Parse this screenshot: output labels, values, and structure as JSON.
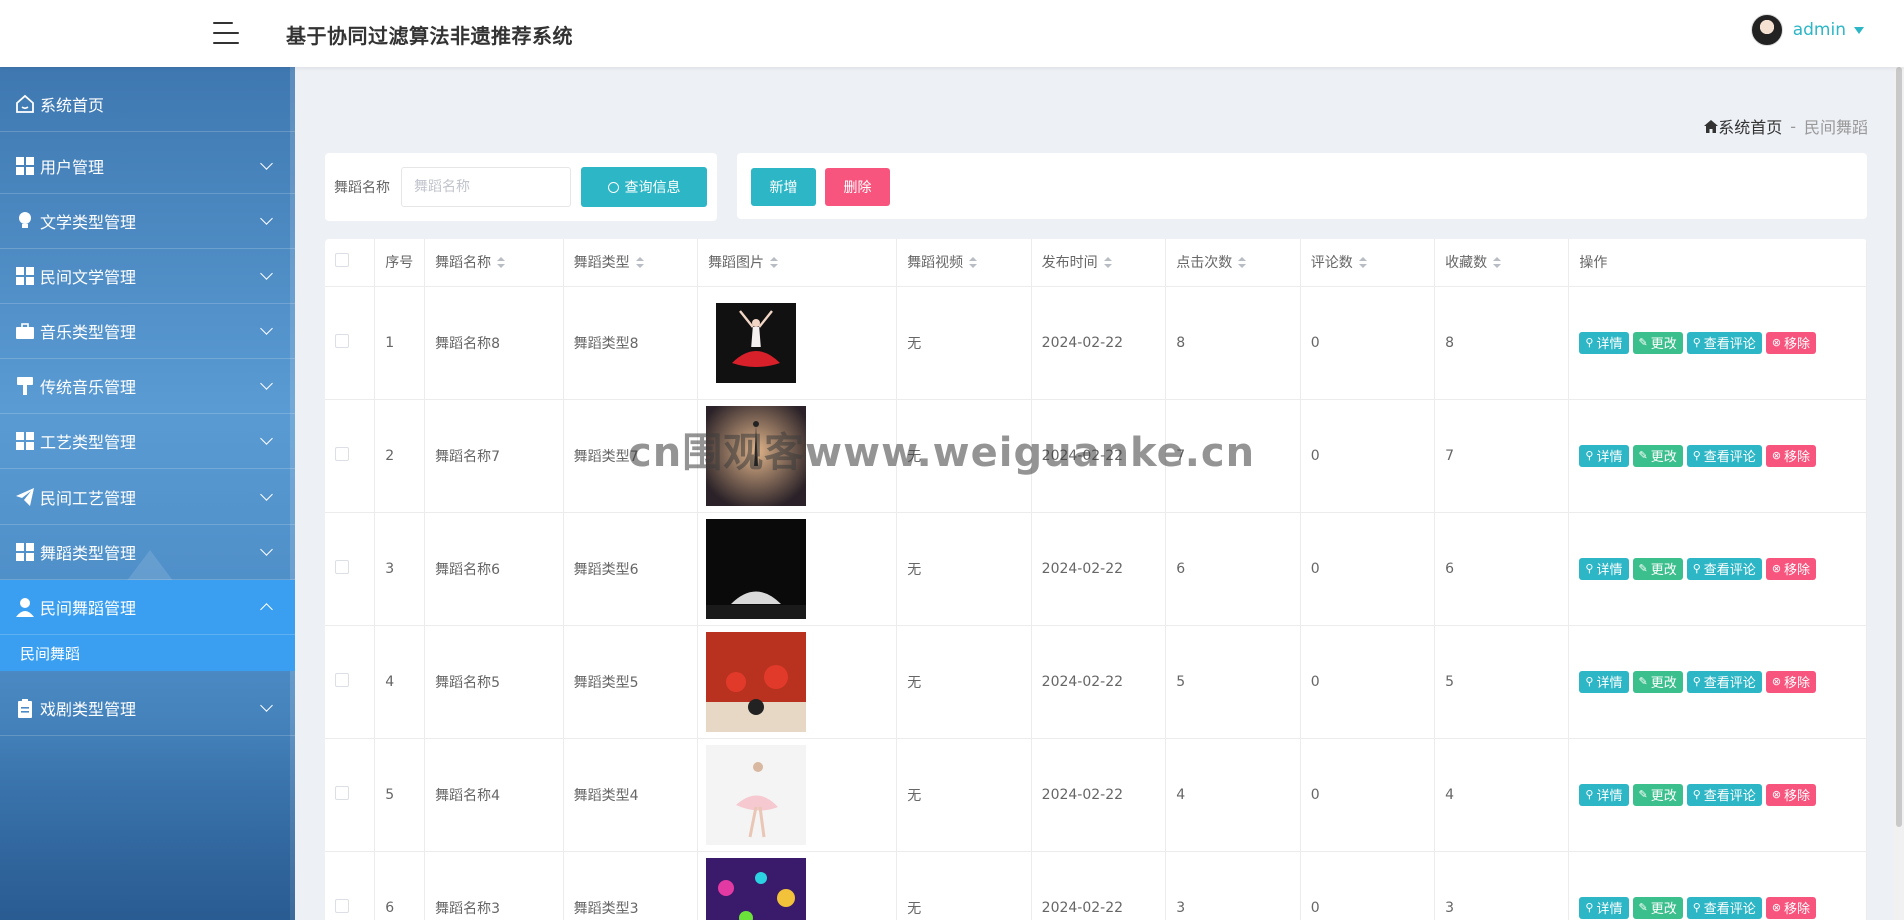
{
  "header": {
    "title": "基于协同过滤算法非遗推荐系统",
    "user": "admin"
  },
  "sidebar": {
    "items": [
      {
        "label": "系统首页",
        "icon": "home-icon"
      },
      {
        "label": "用户管理",
        "icon": "grid-icon"
      },
      {
        "label": "文学类型管理",
        "icon": "lightbulb-icon"
      },
      {
        "label": "民间文学管理",
        "icon": "grid-icon"
      },
      {
        "label": "音乐类型管理",
        "icon": "briefcase-icon"
      },
      {
        "label": "传统音乐管理",
        "icon": "paint-roller-icon"
      },
      {
        "label": "工艺类型管理",
        "icon": "grid-icon"
      },
      {
        "label": "民间工艺管理",
        "icon": "paper-plane-icon"
      },
      {
        "label": "舞蹈类型管理",
        "icon": "grid-icon"
      },
      {
        "label": "民间舞蹈管理",
        "icon": "user-icon"
      },
      {
        "label": "戏剧类型管理",
        "icon": "clipboard-icon"
      }
    ],
    "active_sub": "民间舞蹈"
  },
  "breadcrumb": {
    "home": "系统首页",
    "separator": "-",
    "current": "民间舞蹈"
  },
  "search": {
    "label": "舞蹈名称",
    "placeholder": "舞蹈名称",
    "value": "",
    "button": "查询信息"
  },
  "actions": {
    "add": "新增",
    "delete": "删除"
  },
  "table": {
    "columns": [
      "序号",
      "舞蹈名称",
      "舞蹈类型",
      "舞蹈图片",
      "舞蹈视频",
      "发布时间",
      "点击次数",
      "评论数",
      "收藏数",
      "操作"
    ],
    "rows": [
      {
        "index": "1",
        "name": "舞蹈名称8",
        "type": "舞蹈类型8",
        "video": "无",
        "date": "2024-02-22",
        "clicks": "8",
        "comments": "0",
        "favorites": "8"
      },
      {
        "index": "2",
        "name": "舞蹈名称7",
        "type": "舞蹈类型7",
        "video": "无",
        "date": "2024-02-22",
        "clicks": "7",
        "comments": "0",
        "favorites": "7"
      },
      {
        "index": "3",
        "name": "舞蹈名称6",
        "type": "舞蹈类型6",
        "video": "无",
        "date": "2024-02-22",
        "clicks": "6",
        "comments": "0",
        "favorites": "6"
      },
      {
        "index": "4",
        "name": "舞蹈名称5",
        "type": "舞蹈类型5",
        "video": "无",
        "date": "2024-02-22",
        "clicks": "5",
        "comments": "0",
        "favorites": "5"
      },
      {
        "index": "5",
        "name": "舞蹈名称4",
        "type": "舞蹈类型4",
        "video": "无",
        "date": "2024-02-22",
        "clicks": "4",
        "comments": "0",
        "favorites": "4"
      },
      {
        "index": "6",
        "name": "舞蹈名称3",
        "type": "舞蹈类型3",
        "video": "无",
        "date": "2024-02-22",
        "clicks": "3",
        "comments": "0",
        "favorites": "3"
      }
    ],
    "ops": {
      "detail": "详情",
      "edit": "更改",
      "comments": "查看评论",
      "remove": "移除"
    }
  },
  "watermark": "cn围观客www.weiguanke.cn",
  "colors": {
    "accent": "#2cb6c6",
    "danger": "#f7557e",
    "edit": "#3bbf8c",
    "sidebar_active": "#3a9ff0"
  }
}
